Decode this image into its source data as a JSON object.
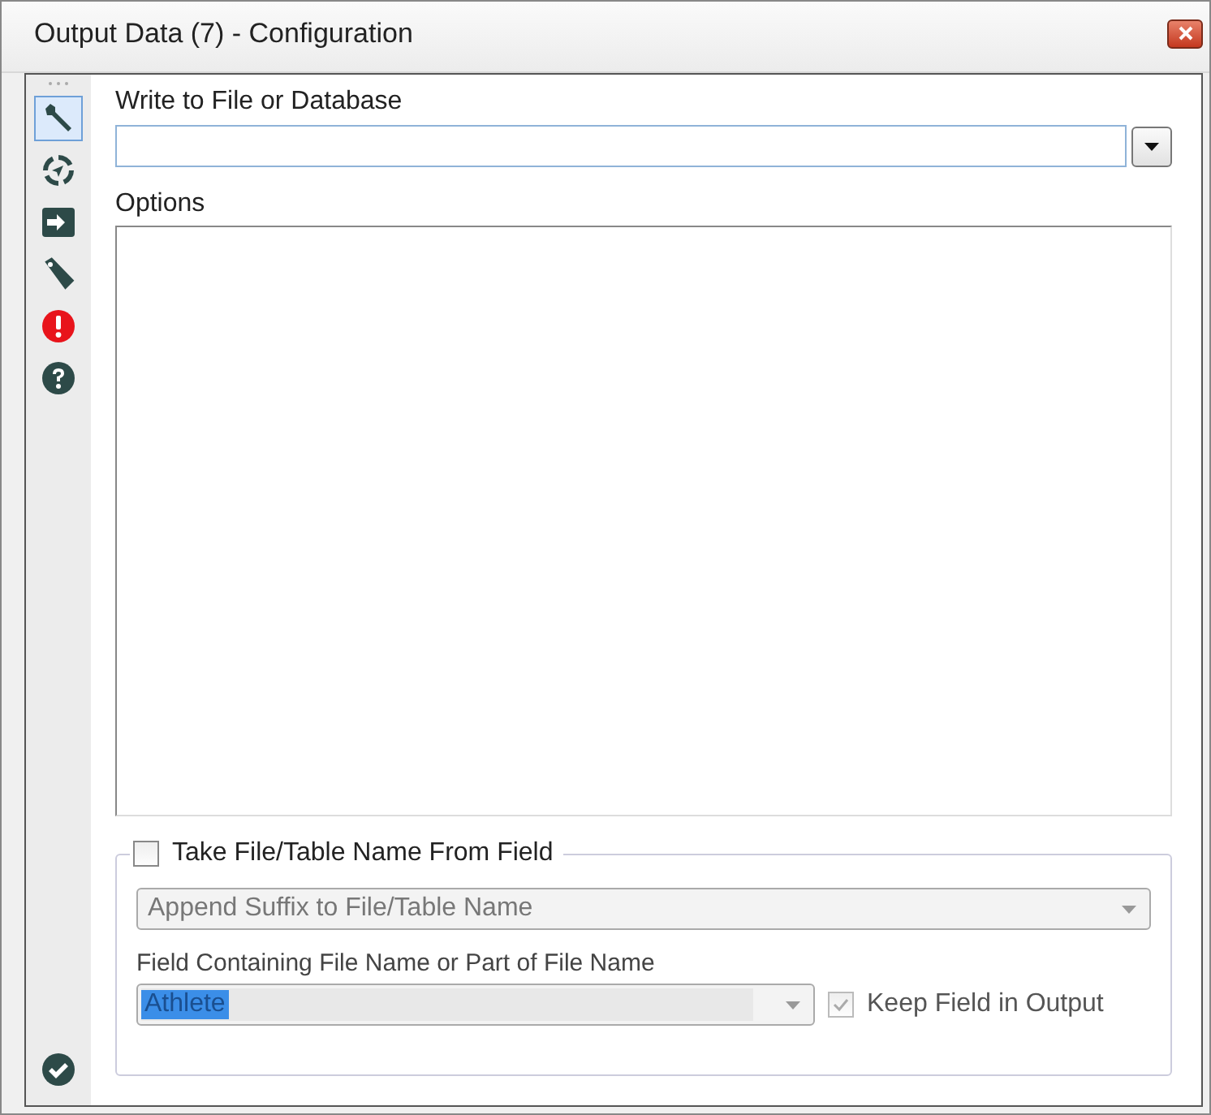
{
  "window": {
    "title": "Output Data (7) - Configuration"
  },
  "sidebar": {
    "items": [
      {
        "kind": "wrench",
        "selected": true
      },
      {
        "kind": "compass",
        "selected": false
      },
      {
        "kind": "input",
        "selected": false
      },
      {
        "kind": "tag",
        "selected": false
      },
      {
        "kind": "error",
        "selected": false
      },
      {
        "kind": "help",
        "selected": false
      }
    ],
    "footer": {
      "kind": "check"
    }
  },
  "write_to": {
    "label": "Write to File or Database"
  },
  "options": {
    "label": "Options"
  },
  "take_name_from_field": {
    "label": "Take File/Table Name From Field",
    "checked": false
  },
  "mode_dropdown": {
    "value": "Append Suffix to File/Table Name",
    "disabled": true
  },
  "field_label": "Field Containing File Name or Part of File Name",
  "field_dropdown": {
    "value": "Athlete",
    "selected": true,
    "disabled": true
  },
  "keep_field": {
    "label": "Keep Field in Output",
    "checked": true,
    "disabled": true
  }
}
